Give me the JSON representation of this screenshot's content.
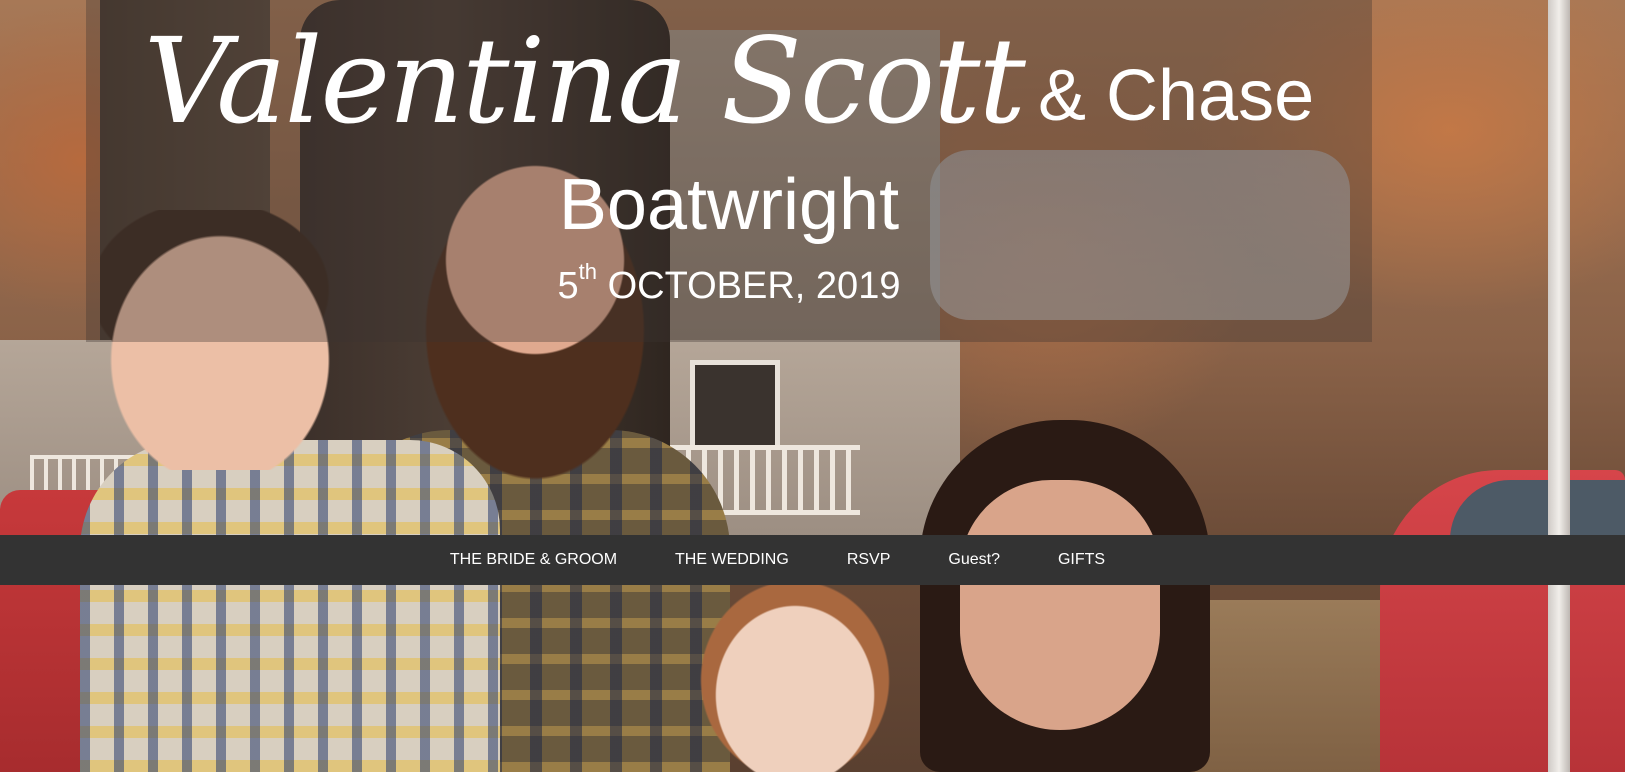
{
  "header": {
    "bride_name": "Valentina Scott",
    "and_groom_first": "& Chase",
    "groom_last": "Boatwright",
    "date_day": "5",
    "date_suffix": "th",
    "date_rest": " OCTOBER, 2019"
  },
  "nav": {
    "items": [
      {
        "label": "THE BRIDE & GROOM"
      },
      {
        "label": "THE WEDDING"
      },
      {
        "label": "RSVP"
      },
      {
        "label": "Guest?"
      },
      {
        "label": "GIFTS"
      }
    ]
  },
  "colors": {
    "nav_background": "#333333",
    "text": "#ffffff"
  }
}
